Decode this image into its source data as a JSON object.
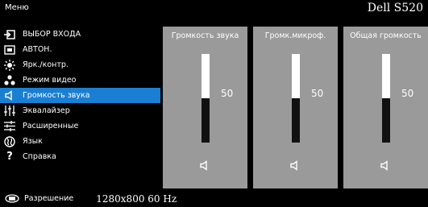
{
  "header": {
    "menu_title": "Меню",
    "brand": "Dell S520"
  },
  "sidebar": {
    "items": [
      {
        "label": "ВЫБОР ВХОДА",
        "icon": "input-source-icon"
      },
      {
        "label": "АВТОН.",
        "icon": "auto-adjust-icon"
      },
      {
        "label": "Ярк./контр.",
        "icon": "brightness-icon"
      },
      {
        "label": "Режим видео",
        "icon": "video-mode-icon"
      },
      {
        "label": "Громкость звука",
        "icon": "speaker-icon",
        "active": true
      },
      {
        "label": "Эквалайзер",
        "icon": "equalizer-icon"
      },
      {
        "label": "Расширенные",
        "icon": "advanced-settings-icon"
      },
      {
        "label": "Язык",
        "icon": "language-icon"
      },
      {
        "label": "Справка",
        "icon": "help-icon"
      }
    ]
  },
  "volume_panels": [
    {
      "title": "Громкость звука",
      "value": "50",
      "level": 0.5
    },
    {
      "title": "Громк.микроф.",
      "value": "50",
      "level": 0.5
    },
    {
      "title": "Общая громкость",
      "value": "50",
      "level": 0.5
    }
  ],
  "footer": {
    "label": "Разрешение",
    "value": "1280x800 60 Hz",
    "icon": "resolution-icon"
  },
  "colors": {
    "active_highlight": "#1a7fd3",
    "panel_bg": "#9a9a9a",
    "background": "#000000"
  }
}
